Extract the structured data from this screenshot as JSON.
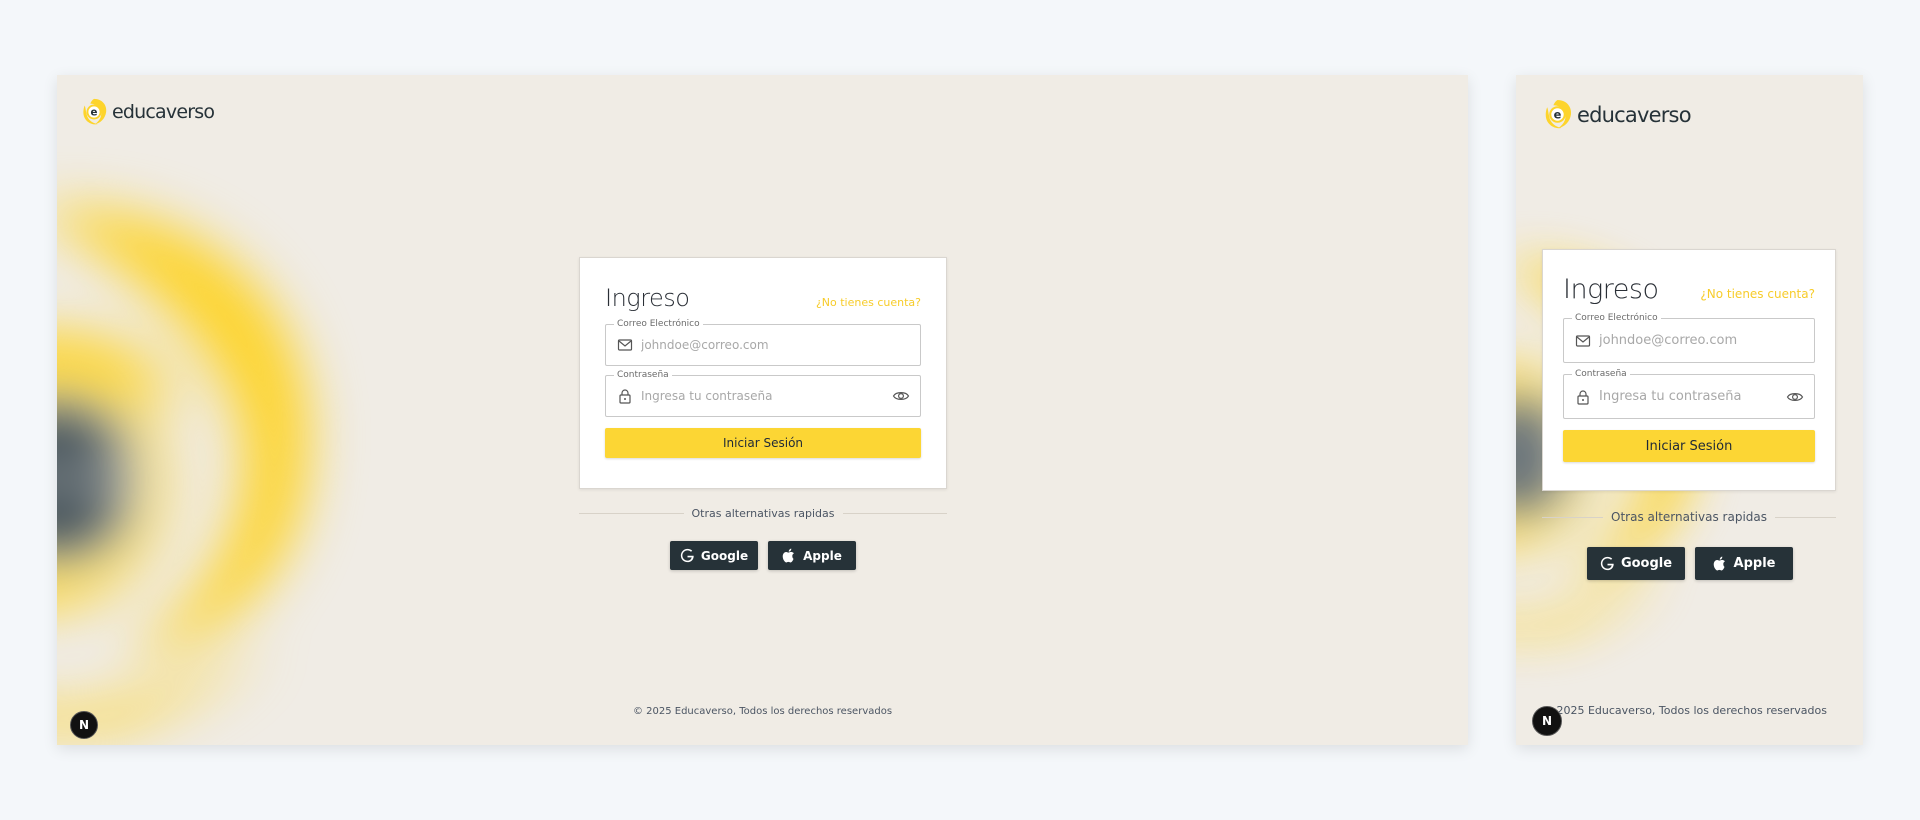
{
  "brand": {
    "name": "educaverso",
    "mark_letter": "e"
  },
  "login": {
    "title": "Ingreso",
    "signup_link": "¿No tienes cuenta?",
    "email": {
      "label": "Correo Electrónico",
      "placeholder": "johndoe@correo.com",
      "value": ""
    },
    "password": {
      "label": "Contraseña",
      "placeholder": "Ingresa tu contraseña",
      "value": ""
    },
    "submit_label": "Iniciar Sesión"
  },
  "alternatives": {
    "label": "Otras alternativas rapidas",
    "google_label": "Google",
    "apple_label": "Apple"
  },
  "footer": {
    "copyright": "© 2025 Educaverso, Todos los derechos reservados"
  },
  "dev_badge": {
    "letter": "N"
  },
  "icons": {
    "email": "mail-icon",
    "password": "lock-icon",
    "toggle": "eye-icon",
    "google": "google-icon",
    "apple": "apple-icon"
  },
  "colors": {
    "accent": "#fcd634",
    "link": "#f7cc2a",
    "dark": "#263238",
    "page_bg": "#f0ece5",
    "canvas_bg": "#f4f7fa"
  }
}
